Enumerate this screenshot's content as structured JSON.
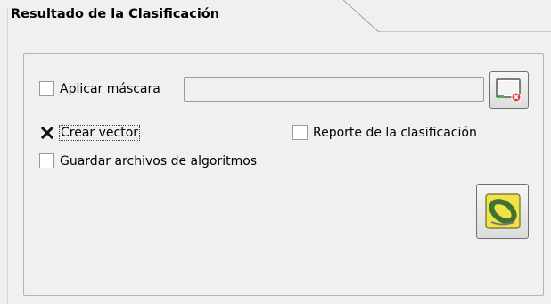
{
  "section": {
    "title": "Resultado de la Clasificación"
  },
  "options": {
    "apply_mask": {
      "label": "Aplicar máscara",
      "checked": false
    },
    "mask_path": {
      "value": ""
    },
    "create_vector": {
      "label": "Crear vector",
      "checked": true
    },
    "classification_report": {
      "label": "Reporte de la clasificación",
      "checked": false
    },
    "save_algorithm_files": {
      "label": "Guardar archivos de algoritmos",
      "checked": false
    }
  },
  "icons": {
    "reset_mask": "reset-mask-icon",
    "run": "run-classification-icon"
  }
}
